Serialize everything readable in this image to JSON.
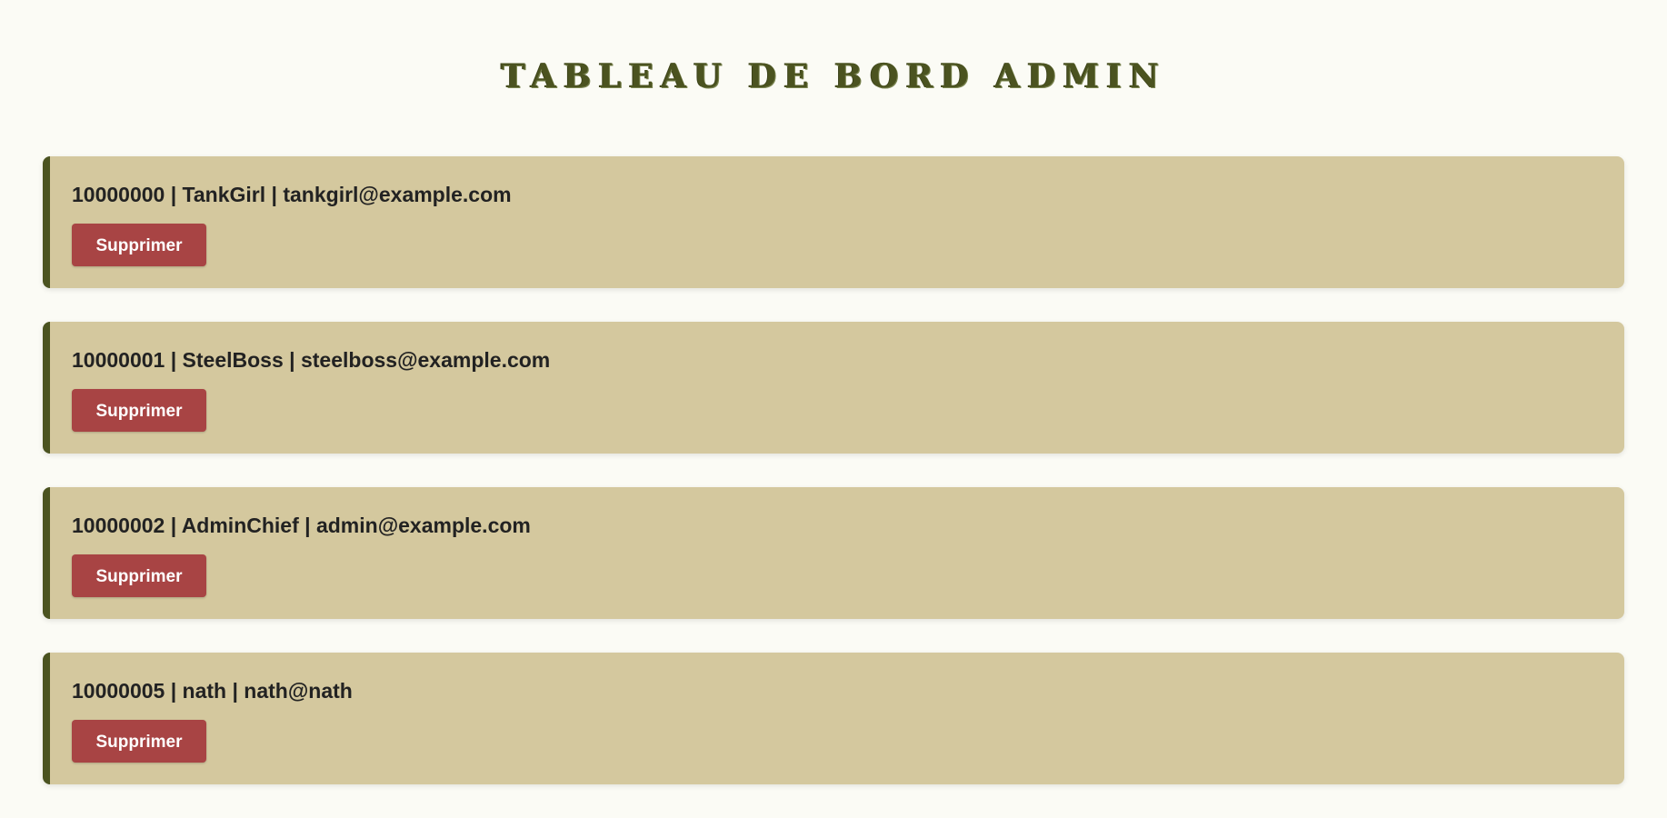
{
  "header": {
    "title": "TABLEAU DE BORD ADMIN"
  },
  "users": [
    {
      "info": "10000000 | TankGirl | tankgirl@example.com",
      "delete_label": "Supprimer"
    },
    {
      "info": "10000001 | SteelBoss | steelboss@example.com",
      "delete_label": "Supprimer"
    },
    {
      "info": "10000002 | AdminChief | admin@example.com",
      "delete_label": "Supprimer"
    },
    {
      "info": "10000005 | nath | nath@nath",
      "delete_label": "Supprimer"
    }
  ],
  "colors": {
    "background": "#fbfbf5",
    "card": "#d4c89e",
    "accent": "#4b5320",
    "danger": "#a84444"
  }
}
